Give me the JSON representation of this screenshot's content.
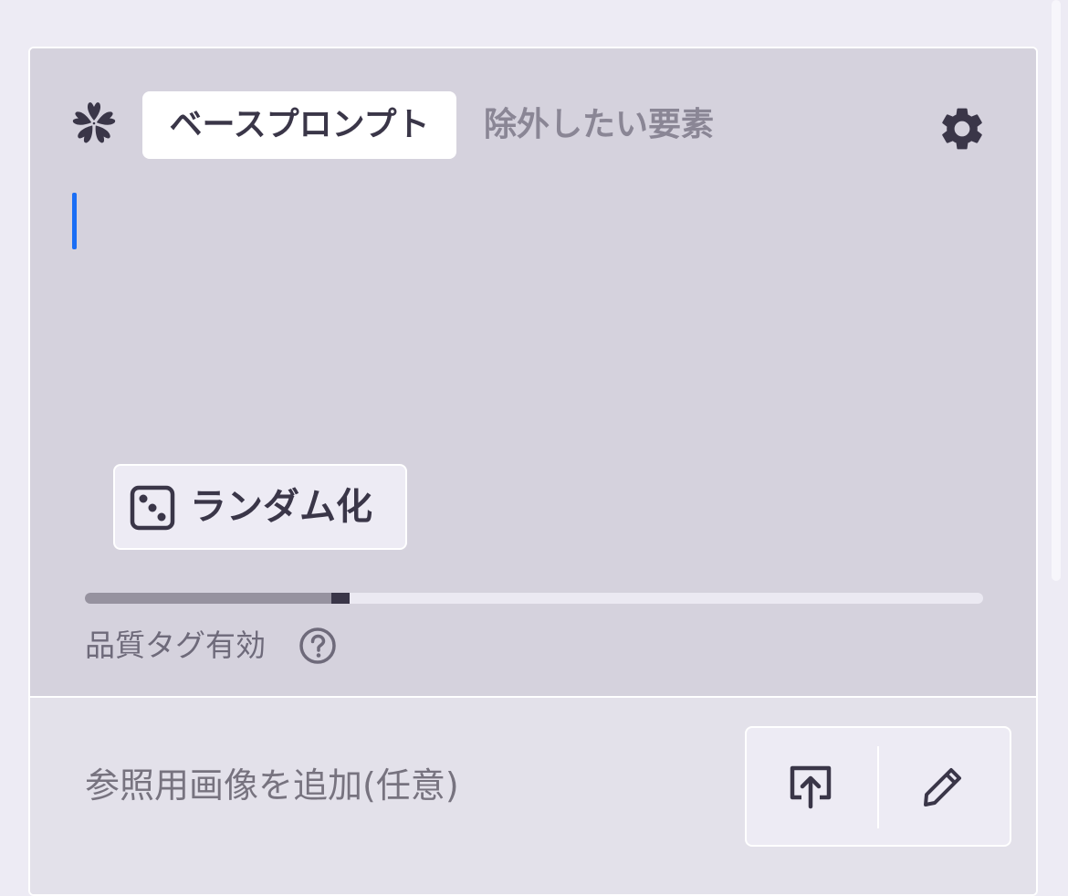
{
  "prompt_panel": {
    "tabs": [
      {
        "label": "ベースプロンプト",
        "active": true
      },
      {
        "label": "除外したい要素",
        "active": false
      }
    ],
    "prompt_text": "",
    "randomize_label": "ランダム化",
    "quality_tags": {
      "label": "品質タグ有効",
      "slider_value_fraction": 0.285
    }
  },
  "reference_image": {
    "label": "参照用画像を追加(任意)"
  },
  "colors": {
    "panel_background": "#d5d2dd",
    "footer_background": "#e3e1ea",
    "text_dark": "#3a3648",
    "text_muted": "#8a8695",
    "caret": "#1a6ef5"
  },
  "icons": {
    "logo": "sakura-icon",
    "settings": "gear-icon",
    "randomize": "dice-icon",
    "help": "question-circle-icon",
    "upload": "upload-icon",
    "edit": "pencil-icon"
  }
}
